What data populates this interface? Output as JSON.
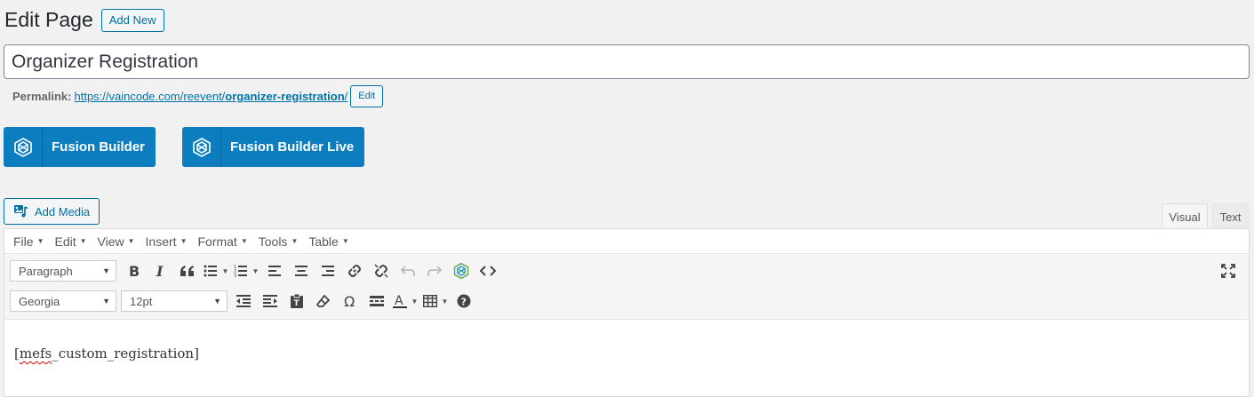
{
  "header": {
    "title": "Edit Page",
    "add_new_label": "Add New"
  },
  "post_title": "Organizer Registration",
  "permalink": {
    "label": "Permalink:",
    "base_url": "https://vaincode.com/reevent/",
    "slug": "organizer-registration",
    "trailing": "/",
    "edit_label": "Edit"
  },
  "fusion": {
    "builder_label": "Fusion Builder",
    "builder_live_label": "Fusion Builder Live"
  },
  "add_media_label": "Add Media",
  "tabs": {
    "visual": "Visual",
    "text": "Text"
  },
  "menubar": [
    {
      "label": "File"
    },
    {
      "label": "Edit"
    },
    {
      "label": "View"
    },
    {
      "label": "Insert"
    },
    {
      "label": "Format"
    },
    {
      "label": "Tools"
    },
    {
      "label": "Table"
    }
  ],
  "toolbar": {
    "format_select": "Paragraph",
    "font_select": "Georgia",
    "size_select": "12pt"
  },
  "content": {
    "spell_part": "mefs",
    "rest": "_custom_registration]",
    "open_bracket": "["
  },
  "colors": {
    "primary": "#0073aa",
    "fusion_button": "#0c7ec0",
    "background": "#f1f1f1"
  }
}
